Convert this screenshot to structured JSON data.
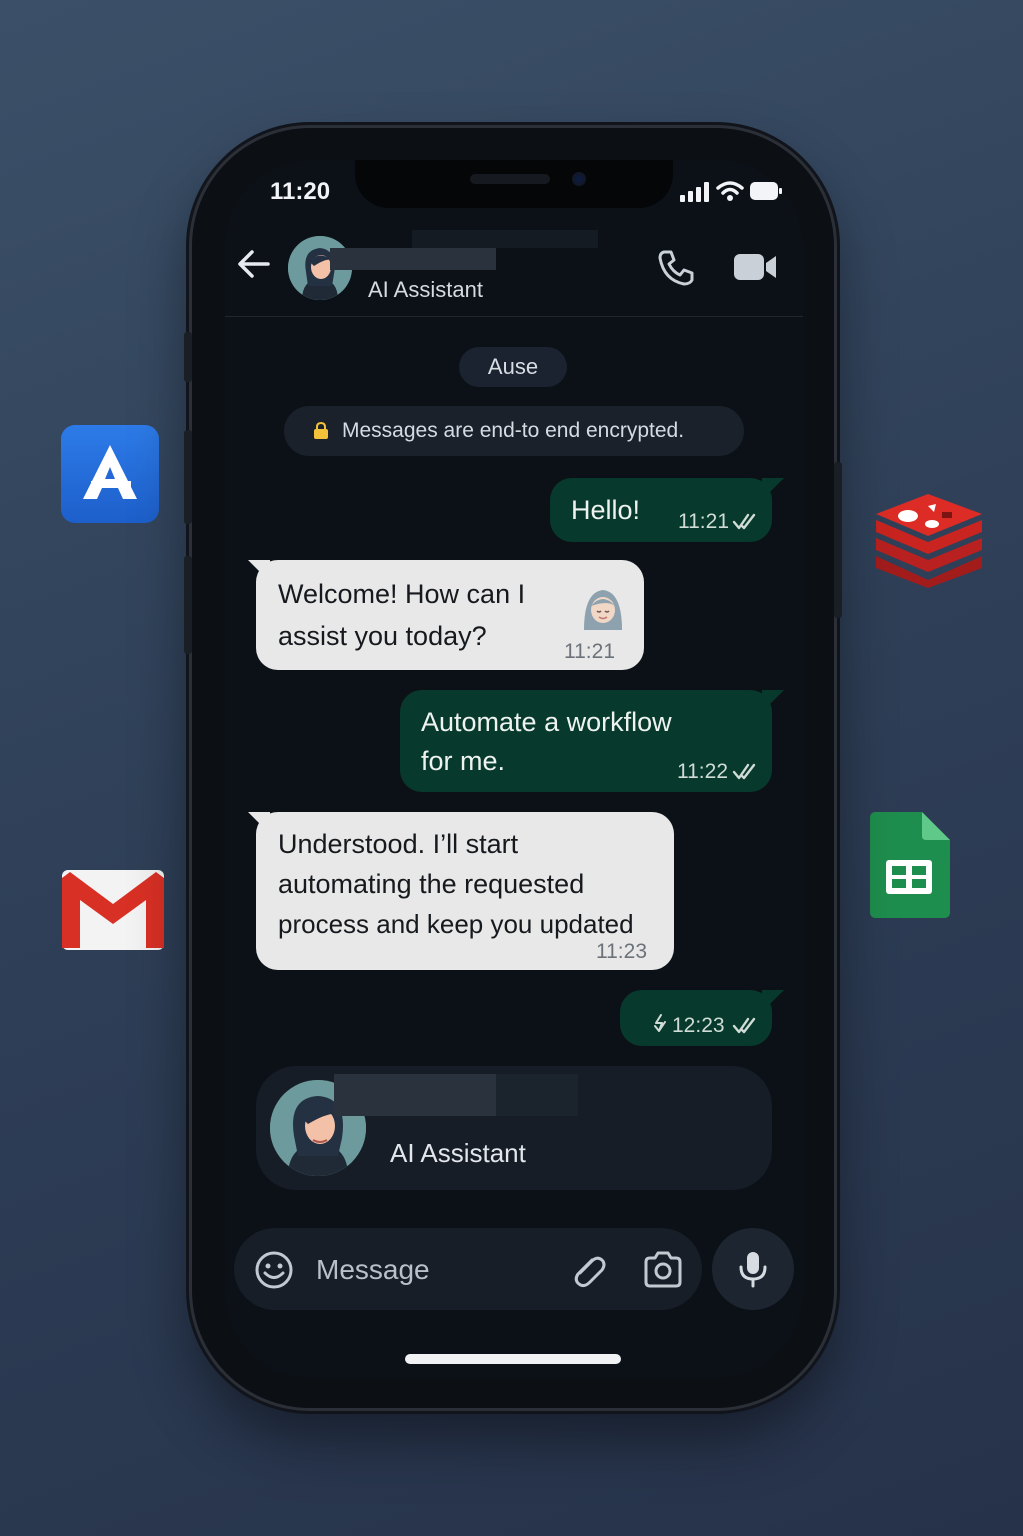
{
  "status_bar": {
    "time": "11:20"
  },
  "header": {
    "contact_subtitle": "AI Assistant"
  },
  "chat": {
    "date_label": "Ause",
    "encryption_notice": "Messages are end-to end encrypted.",
    "messages": [
      {
        "direction": "out",
        "line1": "Hello!",
        "time": "11:21"
      },
      {
        "direction": "in",
        "line1": "Welcome! How can I",
        "line2": "assist you today?",
        "time": "11:21"
      },
      {
        "direction": "out",
        "line1": "Automate a workflow",
        "line2": "for me.",
        "time": "11:22"
      },
      {
        "direction": "in",
        "line1": "Understood. I’ll start",
        "line2": "automating the requested",
        "line3": "process and keep you updated",
        "time": "11:23"
      },
      {
        "direction": "out",
        "time": "12:23"
      }
    ]
  },
  "contact_card": {
    "subtitle": "AI Assistant"
  },
  "composer": {
    "placeholder": "Message"
  },
  "colors": {
    "outgoing_bubble": "#07392d",
    "incoming_bubble": "#e8e8e8",
    "screen_bg": "#0c1118"
  },
  "side_apps": [
    "app-a-icon",
    "redis-icon",
    "gmail-icon",
    "google-sheets-icon"
  ]
}
